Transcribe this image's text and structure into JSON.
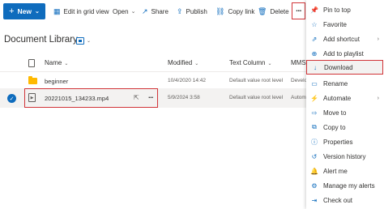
{
  "toolbar": {
    "new_label": "New",
    "edit_grid_label": "Edit in grid view",
    "open_label": "Open",
    "share_label": "Share",
    "publish_label": "Publish",
    "copy_link_label": "Copy link",
    "delete_label": "Delete",
    "more_label": "..."
  },
  "library": {
    "title": "Document Library"
  },
  "columns": {
    "name": "Name",
    "modified": "Modified",
    "text_column": "Text Column",
    "mmsc": "MMSC"
  },
  "rows": [
    {
      "name": "beginner",
      "modified": "10/4/2020 14:42",
      "text_column": "Default value root level",
      "mmsc": "Develop"
    },
    {
      "name": "20221015_134233.mp4",
      "modified": "5/9/2024 3:58",
      "text_column": "Default value root level",
      "mmsc": "Automate"
    }
  ],
  "row_more_label": "...",
  "menu": {
    "items": [
      {
        "label": "Pin to top",
        "icon": "pin-icon"
      },
      {
        "label": "Favorite",
        "icon": "star-icon"
      },
      {
        "label": "Add shortcut",
        "icon": "shortcut-icon"
      },
      {
        "label": "Add to playlist",
        "icon": "playlist-icon"
      },
      {
        "label": "Download",
        "icon": "download-icon"
      },
      {
        "label": "Rename",
        "icon": "rename-icon"
      },
      {
        "label": "Automate",
        "icon": "automate-icon"
      },
      {
        "label": "Move to",
        "icon": "move-icon"
      },
      {
        "label": "Copy to",
        "icon": "copy-icon"
      },
      {
        "label": "Properties",
        "icon": "info-icon"
      },
      {
        "label": "Version history",
        "icon": "history-icon"
      },
      {
        "label": "Alert me",
        "icon": "bell-icon"
      },
      {
        "label": "Manage my alerts",
        "icon": "alerts-icon"
      },
      {
        "label": "Check out",
        "icon": "checkout-icon"
      }
    ]
  },
  "colors": {
    "accent": "#0f6cbd",
    "highlight_border": "#d13438",
    "selected_row": "#f3f2f1"
  }
}
